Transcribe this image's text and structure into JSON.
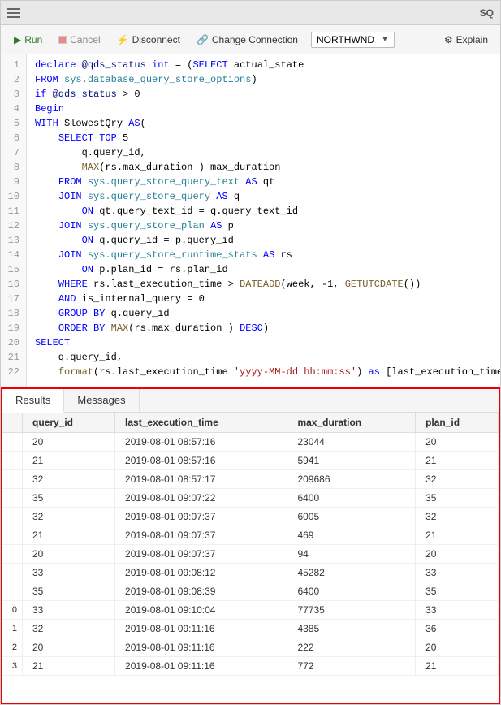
{
  "titleBar": {
    "icon": "☰",
    "title": "",
    "right": "SQ"
  },
  "toolbar": {
    "runLabel": "Run",
    "cancelLabel": "Cancel",
    "disconnectLabel": "Disconnect",
    "changeConnectionLabel": "Change Connection",
    "dbName": "NORTHWND",
    "explainLabel": "Explain"
  },
  "code": {
    "lines": [
      {
        "num": 1,
        "text": "declare @qds_status int = (SELECT actual_state",
        "tokens": [
          {
            "t": "kw",
            "v": "declare"
          },
          {
            "t": "plain",
            "v": " "
          },
          {
            "t": "var",
            "v": "@qds_status"
          },
          {
            "t": "plain",
            "v": " "
          },
          {
            "t": "kw",
            "v": "int"
          },
          {
            "t": "plain",
            "v": " = ("
          },
          {
            "t": "kw",
            "v": "SELECT"
          },
          {
            "t": "plain",
            "v": " actual_state"
          }
        ]
      },
      {
        "num": 2,
        "text": "FROM sys.database_query_store_options)",
        "tokens": [
          {
            "t": "kw",
            "v": "FROM"
          },
          {
            "t": "plain",
            "v": " "
          },
          {
            "t": "sys",
            "v": "sys.database_query_store_options"
          },
          {
            "t": "plain",
            "v": ")"
          }
        ]
      },
      {
        "num": 3,
        "text": "if @qds_status > 0",
        "tokens": [
          {
            "t": "kw",
            "v": "if"
          },
          {
            "t": "plain",
            "v": " "
          },
          {
            "t": "var",
            "v": "@qds_status"
          },
          {
            "t": "plain",
            "v": " > 0"
          }
        ]
      },
      {
        "num": 4,
        "text": "Begin",
        "tokens": [
          {
            "t": "kw",
            "v": "Begin"
          }
        ]
      },
      {
        "num": 5,
        "text": "WITH SlowestQry AS(",
        "tokens": [
          {
            "t": "kw",
            "v": "WITH"
          },
          {
            "t": "plain",
            "v": " SlowestQry "
          },
          {
            "t": "kw",
            "v": "AS"
          },
          {
            "t": "plain",
            "v": "("
          }
        ]
      },
      {
        "num": 6,
        "text": "    SELECT TOP 5",
        "tokens": [
          {
            "t": "plain",
            "v": "    "
          },
          {
            "t": "kw",
            "v": "SELECT TOP"
          },
          {
            "t": "plain",
            "v": " 5"
          }
        ]
      },
      {
        "num": 7,
        "text": "        q.query_id,",
        "tokens": [
          {
            "t": "plain",
            "v": "        q.query_id,"
          }
        ]
      },
      {
        "num": 8,
        "text": "        MAX(rs.max_duration ) max_duration",
        "tokens": [
          {
            "t": "plain",
            "v": "        "
          },
          {
            "t": "fn",
            "v": "MAX"
          },
          {
            "t": "plain",
            "v": "(rs.max_duration ) max_duration"
          }
        ]
      },
      {
        "num": 9,
        "text": "    FROM sys.query_store_query_text AS qt",
        "tokens": [
          {
            "t": "plain",
            "v": "    "
          },
          {
            "t": "kw",
            "v": "FROM"
          },
          {
            "t": "plain",
            "v": " "
          },
          {
            "t": "sys",
            "v": "sys.query_store_query_text"
          },
          {
            "t": "plain",
            "v": " "
          },
          {
            "t": "kw",
            "v": "AS"
          },
          {
            "t": "plain",
            "v": " qt"
          }
        ]
      },
      {
        "num": 10,
        "text": "    JOIN sys.query_store_query AS q",
        "tokens": [
          {
            "t": "plain",
            "v": "    "
          },
          {
            "t": "kw",
            "v": "JOIN"
          },
          {
            "t": "plain",
            "v": " "
          },
          {
            "t": "sys",
            "v": "sys.query_store_query"
          },
          {
            "t": "plain",
            "v": " "
          },
          {
            "t": "kw",
            "v": "AS"
          },
          {
            "t": "plain",
            "v": " q"
          }
        ]
      },
      {
        "num": 11,
        "text": "        ON qt.query_text_id = q.query_text_id",
        "tokens": [
          {
            "t": "plain",
            "v": "        "
          },
          {
            "t": "kw",
            "v": "ON"
          },
          {
            "t": "plain",
            "v": " qt.query_text_id = q.query_text_id"
          }
        ]
      },
      {
        "num": 12,
        "text": "    JOIN sys.query_store_plan AS p",
        "tokens": [
          {
            "t": "plain",
            "v": "    "
          },
          {
            "t": "kw",
            "v": "JOIN"
          },
          {
            "t": "plain",
            "v": " "
          },
          {
            "t": "sys",
            "v": "sys.query_store_plan"
          },
          {
            "t": "plain",
            "v": " "
          },
          {
            "t": "kw",
            "v": "AS"
          },
          {
            "t": "plain",
            "v": " p"
          }
        ]
      },
      {
        "num": 13,
        "text": "        ON q.query_id = p.query_id",
        "tokens": [
          {
            "t": "plain",
            "v": "        "
          },
          {
            "t": "kw",
            "v": "ON"
          },
          {
            "t": "plain",
            "v": " q.query_id = p.query_id"
          }
        ]
      },
      {
        "num": 14,
        "text": "    JOIN sys.query_store_runtime_stats AS rs",
        "tokens": [
          {
            "t": "plain",
            "v": "    "
          },
          {
            "t": "kw",
            "v": "JOIN"
          },
          {
            "t": "plain",
            "v": " "
          },
          {
            "t": "sys",
            "v": "sys.query_store_runtime_stats"
          },
          {
            "t": "plain",
            "v": " "
          },
          {
            "t": "kw",
            "v": "AS"
          },
          {
            "t": "plain",
            "v": " rs"
          }
        ]
      },
      {
        "num": 15,
        "text": "        ON p.plan_id = rs.plan_id",
        "tokens": [
          {
            "t": "plain",
            "v": "        "
          },
          {
            "t": "kw",
            "v": "ON"
          },
          {
            "t": "plain",
            "v": " p.plan_id = rs.plan_id"
          }
        ]
      },
      {
        "num": 16,
        "text": "    WHERE rs.last_execution_time > DATEADD(week, -1, GETUTCDATE())",
        "tokens": [
          {
            "t": "plain",
            "v": "    "
          },
          {
            "t": "kw",
            "v": "WHERE"
          },
          {
            "t": "plain",
            "v": " rs.last_execution_time > "
          },
          {
            "t": "fn",
            "v": "DATEADD"
          },
          {
            "t": "plain",
            "v": "(week, -1, "
          },
          {
            "t": "fn",
            "v": "GETUTCDATE"
          },
          {
            "t": "plain",
            "v": "())"
          }
        ]
      },
      {
        "num": 17,
        "text": "    AND is_internal_query = 0",
        "tokens": [
          {
            "t": "plain",
            "v": "    "
          },
          {
            "t": "kw",
            "v": "AND"
          },
          {
            "t": "plain",
            "v": " is_internal_query = 0"
          }
        ]
      },
      {
        "num": 18,
        "text": "    GROUP BY q.query_id",
        "tokens": [
          {
            "t": "plain",
            "v": "    "
          },
          {
            "t": "kw",
            "v": "GROUP BY"
          },
          {
            "t": "plain",
            "v": " q.query_id"
          }
        ]
      },
      {
        "num": 19,
        "text": "    ORDER BY MAX(rs.max_duration ) DESC)",
        "tokens": [
          {
            "t": "plain",
            "v": "    "
          },
          {
            "t": "kw",
            "v": "ORDER BY"
          },
          {
            "t": "plain",
            "v": " "
          },
          {
            "t": "fn",
            "v": "MAX"
          },
          {
            "t": "plain",
            "v": "(rs.max_duration ) "
          },
          {
            "t": "kw",
            "v": "DESC"
          },
          {
            "t": "plain",
            "v": ")"
          }
        ]
      },
      {
        "num": 20,
        "text": "SELECT",
        "tokens": [
          {
            "t": "kw",
            "v": "SELECT"
          }
        ]
      },
      {
        "num": 21,
        "text": "    q.query_id,",
        "tokens": [
          {
            "t": "plain",
            "v": "    q.query_id,"
          }
        ]
      },
      {
        "num": 22,
        "text": "    format(rs.last_execution_time 'yyyy-MM-dd hh:mm:ss') as [last_execution_time]",
        "tokens": [
          {
            "t": "plain",
            "v": "    "
          },
          {
            "t": "fn",
            "v": "format"
          },
          {
            "t": "plain",
            "v": "(rs.last_execution_time "
          },
          {
            "t": "str",
            "v": "'yyyy-MM-dd hh:mm:ss'"
          },
          {
            "t": "plain",
            "v": ") "
          },
          {
            "t": "kw",
            "v": "as"
          },
          {
            "t": "plain",
            "v": " [last_execution_time]"
          }
        ]
      }
    ]
  },
  "results": {
    "tabs": [
      "Results",
      "Messages"
    ],
    "activeTab": "Results",
    "columns": [
      "query_id",
      "last_execution_time",
      "max_duration",
      "plan_id"
    ],
    "rows": [
      {
        "rowNum": "",
        "query_id": "20",
        "last_execution_time": "2019-08-01 08:57:16",
        "max_duration": "23044",
        "plan_id": "20"
      },
      {
        "rowNum": "",
        "query_id": "21",
        "last_execution_time": "2019-08-01 08:57:16",
        "max_duration": "5941",
        "plan_id": "21"
      },
      {
        "rowNum": "",
        "query_id": "32",
        "last_execution_time": "2019-08-01 08:57:17",
        "max_duration": "209686",
        "plan_id": "32"
      },
      {
        "rowNum": "",
        "query_id": "35",
        "last_execution_time": "2019-08-01 09:07:22",
        "max_duration": "6400",
        "plan_id": "35"
      },
      {
        "rowNum": "",
        "query_id": "32",
        "last_execution_time": "2019-08-01 09:07:37",
        "max_duration": "6005",
        "plan_id": "32"
      },
      {
        "rowNum": "",
        "query_id": "21",
        "last_execution_time": "2019-08-01 09:07:37",
        "max_duration": "469",
        "plan_id": "21"
      },
      {
        "rowNum": "",
        "query_id": "20",
        "last_execution_time": "2019-08-01 09:07:37",
        "max_duration": "94",
        "plan_id": "20"
      },
      {
        "rowNum": "",
        "query_id": "33",
        "last_execution_time": "2019-08-01 09:08:12",
        "max_duration": "45282",
        "plan_id": "33"
      },
      {
        "rowNum": "",
        "query_id": "35",
        "last_execution_time": "2019-08-01 09:08:39",
        "max_duration": "6400",
        "plan_id": "35"
      },
      {
        "rowNum": "0",
        "query_id": "33",
        "last_execution_time": "2019-08-01 09:10:04",
        "max_duration": "77735",
        "plan_id": "33"
      },
      {
        "rowNum": "1",
        "query_id": "32",
        "last_execution_time": "2019-08-01 09:11:16",
        "max_duration": "4385",
        "plan_id": "36"
      },
      {
        "rowNum": "2",
        "query_id": "20",
        "last_execution_time": "2019-08-01 09:11:16",
        "max_duration": "222",
        "plan_id": "20"
      },
      {
        "rowNum": "3",
        "query_id": "21",
        "last_execution_time": "2019-08-01 09:11:16",
        "max_duration": "772",
        "plan_id": "21"
      }
    ]
  }
}
